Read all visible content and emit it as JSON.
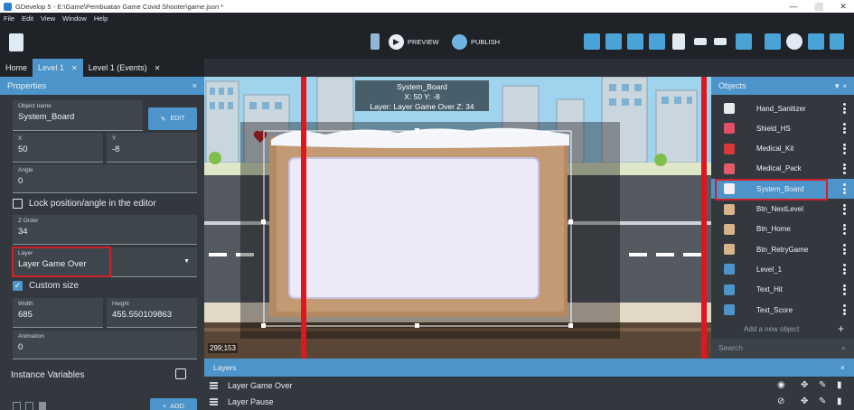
{
  "window": {
    "title": "GDevelop 5 - E:\\Game\\Pembuatan Game Covid Shooter\\game.json *",
    "minimize": "—",
    "maximize": "⬜",
    "close": "✕"
  },
  "menu": [
    "File",
    "Edit",
    "View",
    "Window",
    "Help"
  ],
  "toolbar": {
    "preview_label": "PREVIEW",
    "publish_label": "PUBLISH"
  },
  "tabs": [
    {
      "label": "Home",
      "closable": false
    },
    {
      "label": "Level 1",
      "closable": true,
      "active": true
    },
    {
      "label": "Level 1 (Events)",
      "closable": true
    }
  ],
  "properties": {
    "title": "Properties",
    "close": "×",
    "object_name_label": "Object name",
    "object_name": "System_Board",
    "edit_label": "EDIT",
    "x_label": "X",
    "x": "50",
    "y_label": "Y",
    "y": "-8",
    "angle_label": "Angle",
    "angle": "0",
    "lock_label": "Lock position/angle in the editor",
    "lock_checked": false,
    "zorder_label": "Z Order",
    "zorder": "34",
    "layer_label": "Layer",
    "layer": "Layer Game Over",
    "custom_size_label": "Custom size",
    "custom_size_checked": true,
    "width_label": "Width",
    "width": "685",
    "height_label": "Height",
    "height": "455.550109863",
    "animation_label": "Animation",
    "animation": "0",
    "instance_vars_label": "Instance Variables",
    "add_label": "ADD"
  },
  "scene": {
    "tooltip_name": "System_Board",
    "tooltip_xy": "X: 50  Y: -8",
    "tooltip_layer": "Layer: Layer Game Over  Z: 34",
    "cursor_coords": "299;153"
  },
  "objects": {
    "title": "Objects",
    "items": [
      {
        "name": "Hand_Sanitizer",
        "icon": "bottle-icon",
        "color": "#e8ecef"
      },
      {
        "name": "Shield_HS",
        "icon": "shield-icon",
        "color": "#e0506a"
      },
      {
        "name": "Medical_Kit",
        "icon": "medkit-icon",
        "color": "#d83a3a"
      },
      {
        "name": "Medical_Pack",
        "icon": "medpack-icon",
        "color": "#e05a6a"
      },
      {
        "name": "System_Board",
        "icon": "board-icon",
        "color": "#f0f0f6",
        "selected": true
      },
      {
        "name": "Btn_NextLevel",
        "icon": "button-icon",
        "color": "#d7b38a"
      },
      {
        "name": "Btn_Home",
        "icon": "button-icon",
        "color": "#d7b38a"
      },
      {
        "name": "Btn_RetryGame",
        "icon": "button-icon",
        "color": "#d7b38a"
      },
      {
        "name": "Level_1",
        "icon": "text-icon",
        "color": "#4c94c9"
      },
      {
        "name": "Text_Hit",
        "icon": "text-icon",
        "color": "#4c94c9"
      },
      {
        "name": "Text_Score",
        "icon": "text-icon",
        "color": "#4c94c9"
      }
    ],
    "add_label": "Add a new object",
    "search_placeholder": "Search"
  },
  "layers": {
    "title": "Layers",
    "items": [
      {
        "name": "Layer Game Over",
        "visible": true
      },
      {
        "name": "Layer Pause",
        "visible": false
      }
    ]
  },
  "colors": {
    "accent": "#4c94c9",
    "panel": "#33383f",
    "highlight": "#d0202a"
  }
}
